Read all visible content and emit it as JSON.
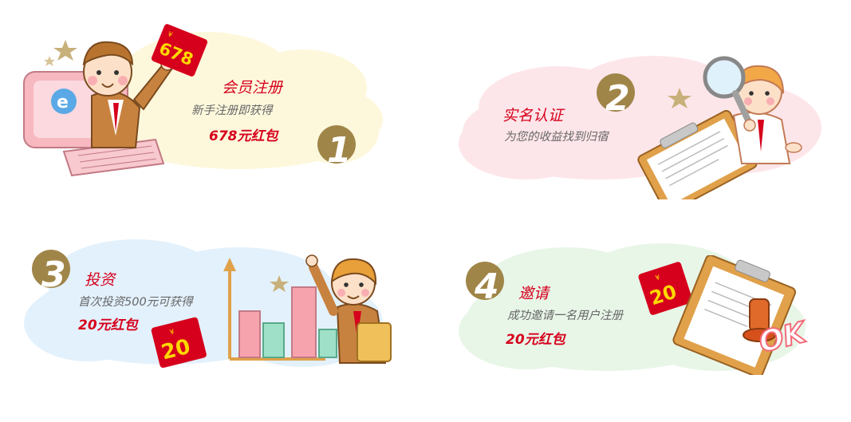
{
  "steps": [
    {
      "number": "1",
      "title": "会员注册",
      "desc": "新手注册即获得",
      "reward": "678元红包",
      "badge_amount": "678"
    },
    {
      "number": "2",
      "title": "实名认证",
      "desc": "为您的收益找到归宿"
    },
    {
      "number": "3",
      "title": "投资",
      "desc": "首次投资500元可获得",
      "reward": "20元红包",
      "badge_amount": "20"
    },
    {
      "number": "4",
      "title": "邀请",
      "desc": "成功邀请一名用户注册",
      "reward": "20元红包",
      "badge_amount": "20",
      "stamp_text": "OK"
    }
  ],
  "currency_symbol": "¥",
  "colors": {
    "accent_red": "#d6001c",
    "number_gold": "#a08548",
    "cloud_yellow": "#fdf8dc",
    "cloud_pink": "#fde6ea",
    "cloud_blue": "#e3f1fc",
    "cloud_green": "#e8f6e8"
  }
}
